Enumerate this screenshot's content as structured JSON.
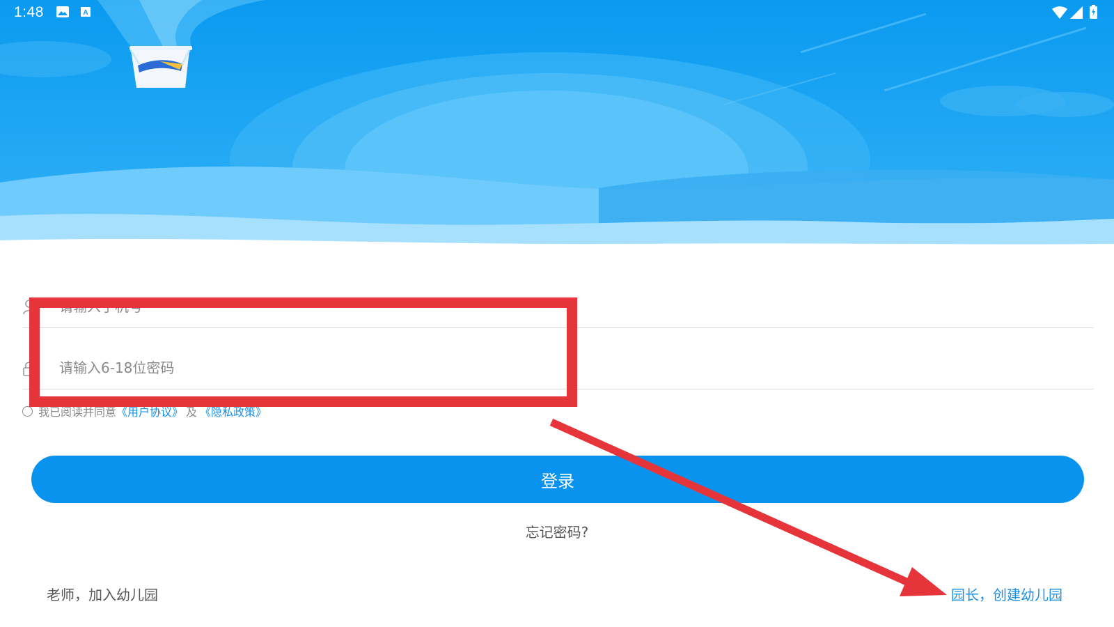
{
  "status_bar": {
    "time": "1:48",
    "icons": [
      "image-icon",
      "a-notification-icon",
      "wifi-icon",
      "signal-icon",
      "battery-charging-icon"
    ]
  },
  "colors": {
    "sky_top": "#0a9af0",
    "sky_light": "#5fc4fb",
    "accent": "#0a93ee",
    "link": "#1a8fe3",
    "annotation_red": "#e5353a"
  },
  "form": {
    "phone": {
      "icon": "user-icon",
      "placeholder": "请输入手机号",
      "value": ""
    },
    "password": {
      "icon": "lock-icon",
      "placeholder": "请输入6-18位密码",
      "value": ""
    },
    "agreement": {
      "checked": false,
      "prefix": "我已阅读并同意",
      "user_agreement": "《用户协议》",
      "conjunction": "及",
      "privacy_policy": "《隐私政策》"
    },
    "login_label": "登录",
    "forgot_password": "忘记密码?"
  },
  "footer": {
    "teacher_join": "老师，加入幼儿园",
    "principal_create": "园长，创建幼儿园"
  }
}
